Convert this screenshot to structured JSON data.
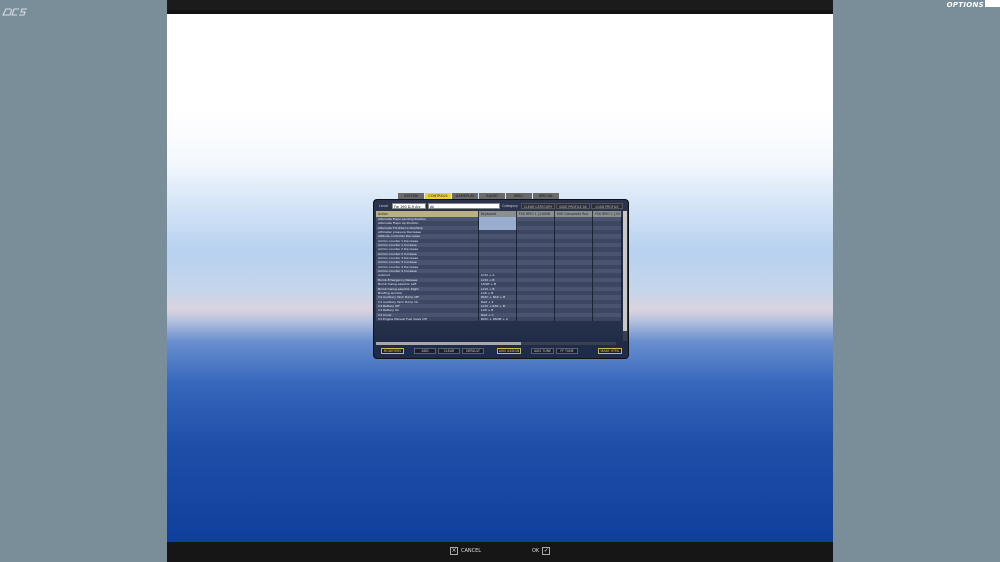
{
  "app": {
    "logo_text": "DCS",
    "options_title": "OPTIONS"
  },
  "tabs": [
    {
      "label": "SYSTEM",
      "active": false
    },
    {
      "label": "CONTROLS",
      "active": true
    },
    {
      "label": "GAMEPLAY",
      "active": false
    },
    {
      "label": "AUDIO",
      "active": false
    },
    {
      "label": "MISC.",
      "active": false
    },
    {
      "label": "SPECIAL",
      "active": false
    }
  ],
  "controls_bar": {
    "aircraft_label": "Level",
    "aircraft_value": "Fw 190 D-9 Arc",
    "filter_value": "All",
    "category_label": "Category",
    "clear_category": "CLEAR CATEGORY",
    "save_profile": "SAVE PROFILE AS",
    "load_profile": "LOAD PROFILE"
  },
  "table": {
    "headers": [
      "Action",
      "Keyboard",
      "FSX RPIO 1 {2400B",
      "MOI Composite Rud",
      "FSX RPIO 1 {34"
    ],
    "rows": [
      [
        "Alternate Flaps Landing Position",
        "",
        "",
        "",
        ""
      ],
      [
        "Alternate Flaps Up Position",
        "",
        "",
        "",
        ""
      ],
      [
        "Alternate Throttle to Idle/Stop",
        "",
        "",
        "",
        ""
      ],
      [
        "Altimeter pressure Decrease",
        "",
        "",
        "",
        ""
      ],
      [
        "Altitude controller Decrease",
        "",
        "",
        "",
        ""
      ],
      [
        "Ammo counter 1 Decrease",
        "",
        "",
        "",
        ""
      ],
      [
        "Ammo counter 1 Increase",
        "",
        "",
        "",
        ""
      ],
      [
        "Ammo counter 2 Decrease",
        "",
        "",
        "",
        ""
      ],
      [
        "Ammo counter 2 Increase",
        "",
        "",
        "",
        ""
      ],
      [
        "Ammo counter 3 Decrease",
        "",
        "",
        "",
        ""
      ],
      [
        "Ammo counter 3 Increase",
        "",
        "",
        "",
        ""
      ],
      [
        "Ammo counter 4 Decrease",
        "",
        "",
        "",
        ""
      ],
      [
        "Ammo counter 4 Increase",
        "",
        "",
        "",
        ""
      ],
      [
        "Autorud",
        "LCtrl + A",
        "",
        "",
        ""
      ],
      [
        "Bomb Emergency Release",
        "LCtrl + B",
        "",
        "",
        ""
      ],
      [
        "Bomb fusing selector Left",
        "LShift + B",
        "",
        "",
        ""
      ],
      [
        "Bomb fusing selector Right",
        "LCtrl + B",
        "",
        "",
        ""
      ],
      [
        "Briefing window",
        "LAlt + B",
        "",
        "",
        ""
      ],
      [
        "C4 Auxiliary Tank Pump Off",
        "RCtrl + RAlt + B",
        "",
        "",
        ""
      ],
      [
        "C4 Auxiliary Tank Pump On",
        "RAlt + 4",
        "",
        "",
        ""
      ],
      [
        "C4 Battery Off",
        "LCtrl + RAlt + B",
        "",
        "",
        ""
      ],
      [
        "C4 Battery On",
        "LAlt + B",
        "",
        "",
        ""
      ],
      [
        "C4 Cover",
        "RAlt + C",
        "",
        "",
        ""
      ],
      [
        "C4 Engine Manual Fuel Valve Off",
        "RCtrl + RShift + C",
        "",
        "",
        ""
      ]
    ]
  },
  "buttons": {
    "modifiers": "MODIFIERS",
    "add": "ADD",
    "clear": "CLEAR",
    "default": "DEFAULT",
    "axis_assign": "AXIS ASSIGN",
    "axis_tune": "AXIS TUNE",
    "ff_tune": "FF TUNE",
    "make_html": "MAKE HTML"
  },
  "bottom": {
    "cancel": "CANCEL",
    "ok": "OK"
  }
}
